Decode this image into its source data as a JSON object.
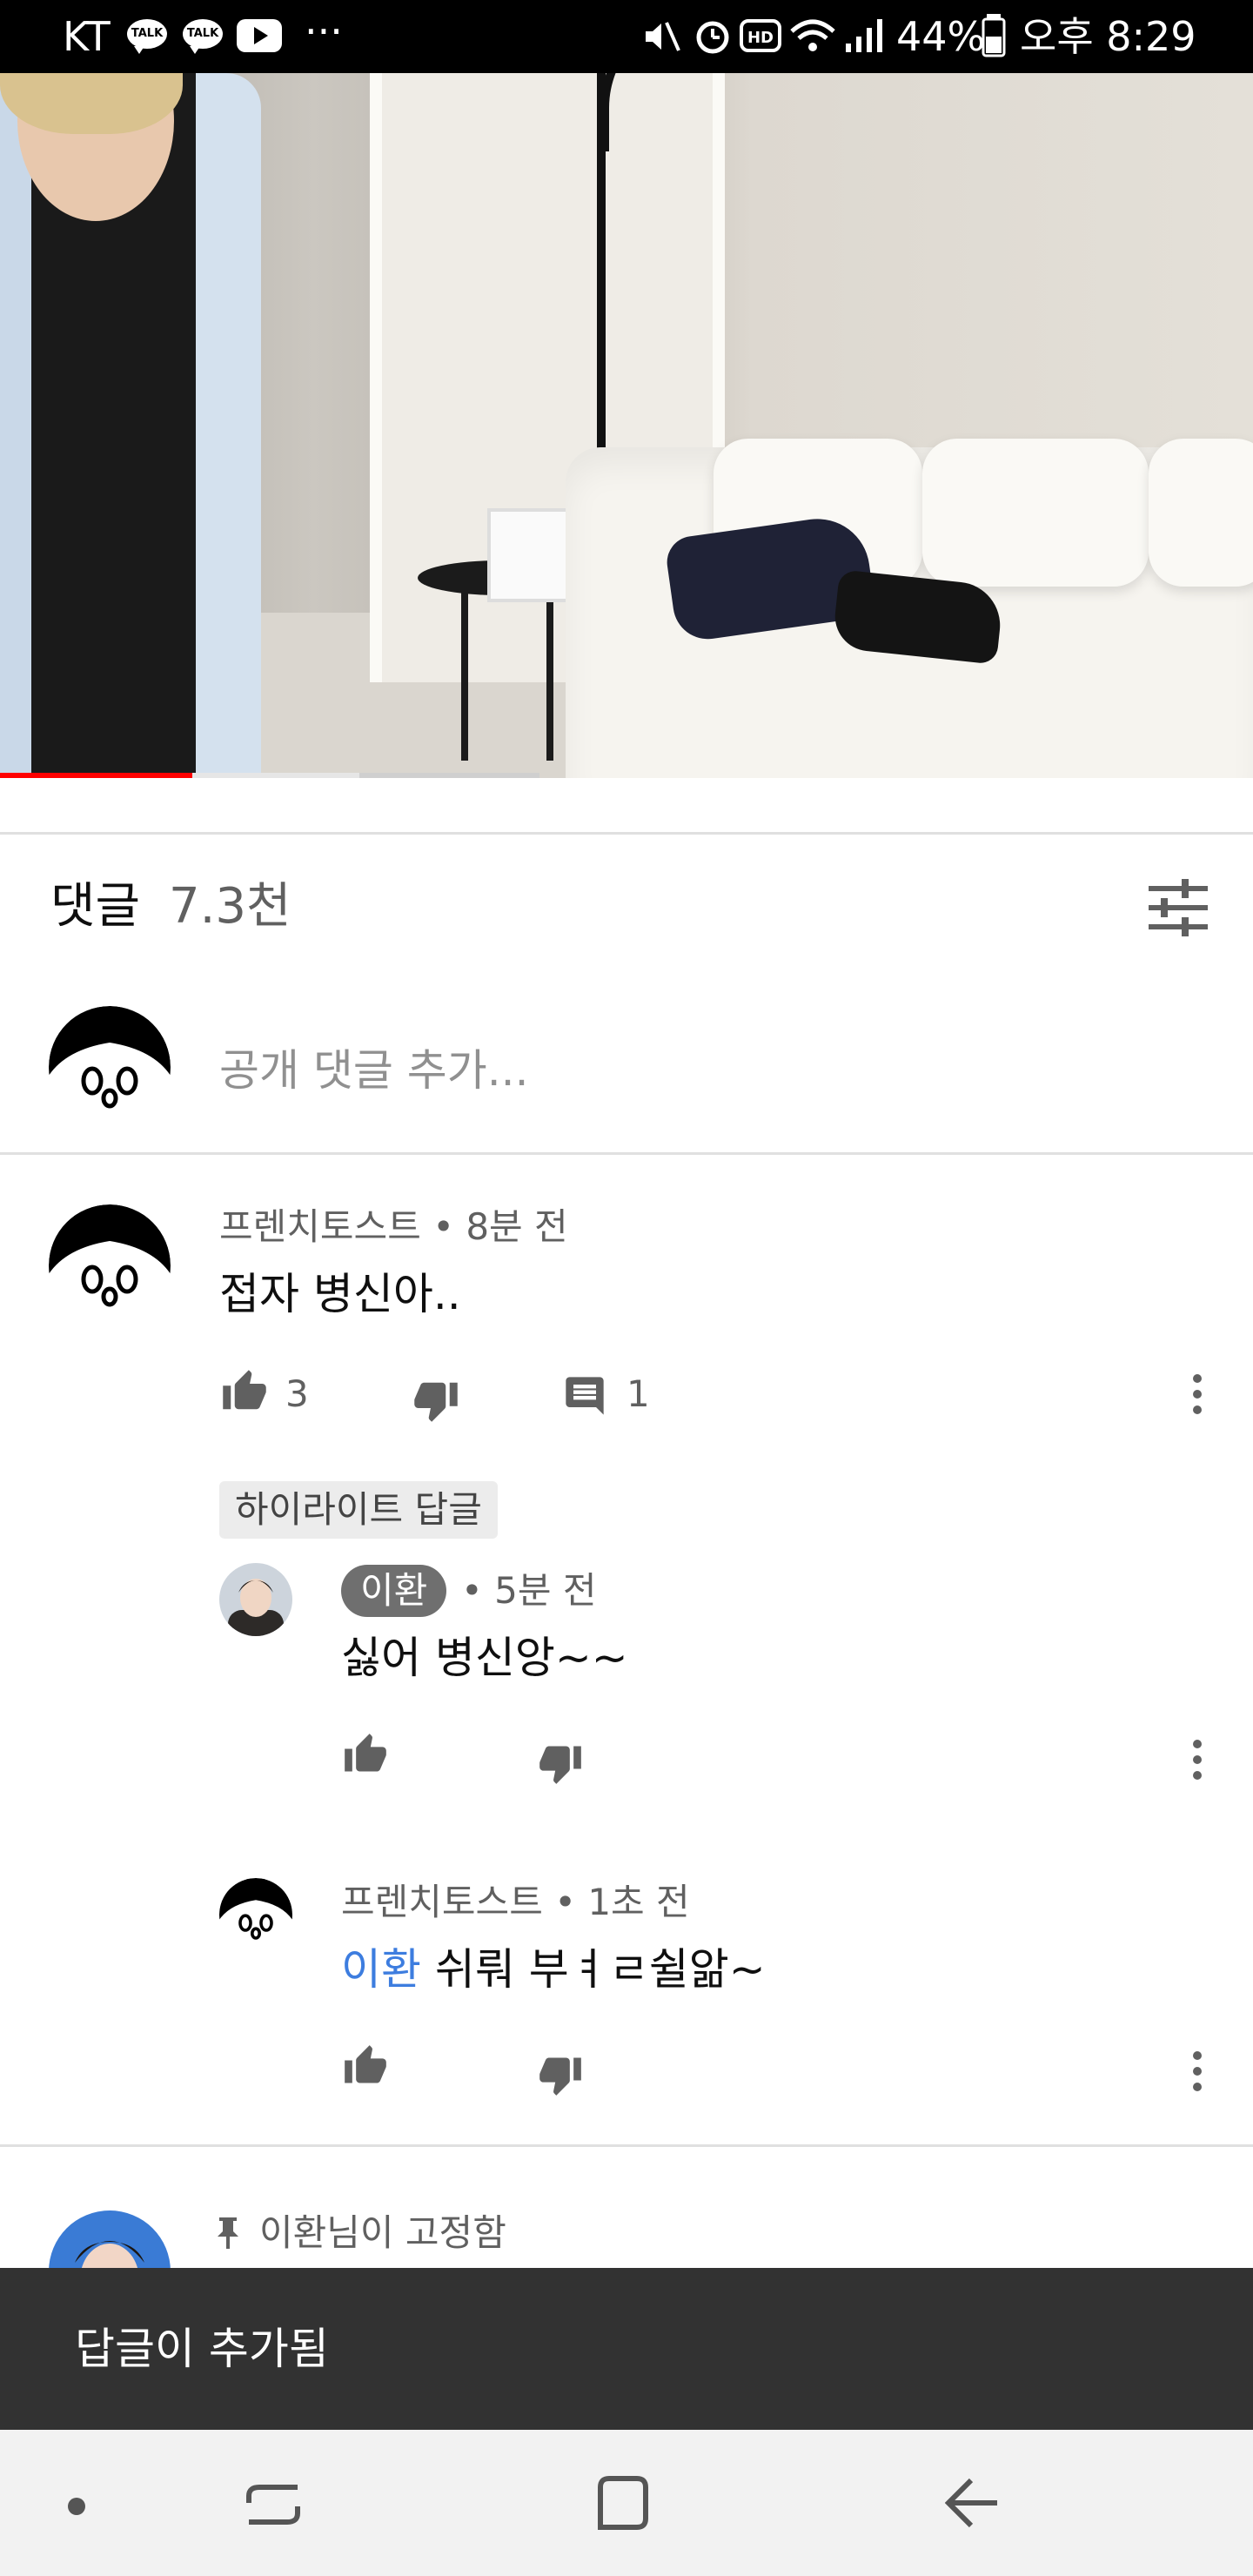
{
  "status_bar": {
    "carrier": "KT",
    "notif_icons": [
      "talk-icon",
      "talk-icon",
      "youtube-icon"
    ],
    "talk_label": "TALK",
    "more": "···",
    "battery": "44%",
    "time": "오후 8:29",
    "status_icons": [
      "mute-icon",
      "alarm-icon",
      "hd-icon",
      "wifi-icon",
      "signal-icon",
      "battery-icon"
    ]
  },
  "video": {
    "progress_fraction": 0.15,
    "buffered_fraction": 0.28
  },
  "comments": {
    "title": "댓글",
    "count": "7.3천",
    "add_placeholder": "공개 댓글 추가..."
  },
  "thread": {
    "author": "프렌치토스트",
    "time": "• 8분 전",
    "text": "접자 병신아..",
    "likes": "3",
    "replies": "1",
    "highlight_label": "하이라이트 답글",
    "reply1": {
      "author": "이환",
      "time": "• 5분 전",
      "text": "싫어 병신앙~~"
    },
    "reply2": {
      "author": "프렌치토스트",
      "time": "• 1초 전",
      "mention": "이환",
      "text": " 쉬뤄 부ㅕㄹ쉴앎~"
    }
  },
  "pinned": {
    "label": "이환님이 고정함"
  },
  "snackbar": {
    "text": "답글이 추가됨"
  },
  "colors": {
    "accent_red": "#ff0000",
    "mention_blue": "#3d7ddf",
    "snackbar_bg": "#323232"
  }
}
